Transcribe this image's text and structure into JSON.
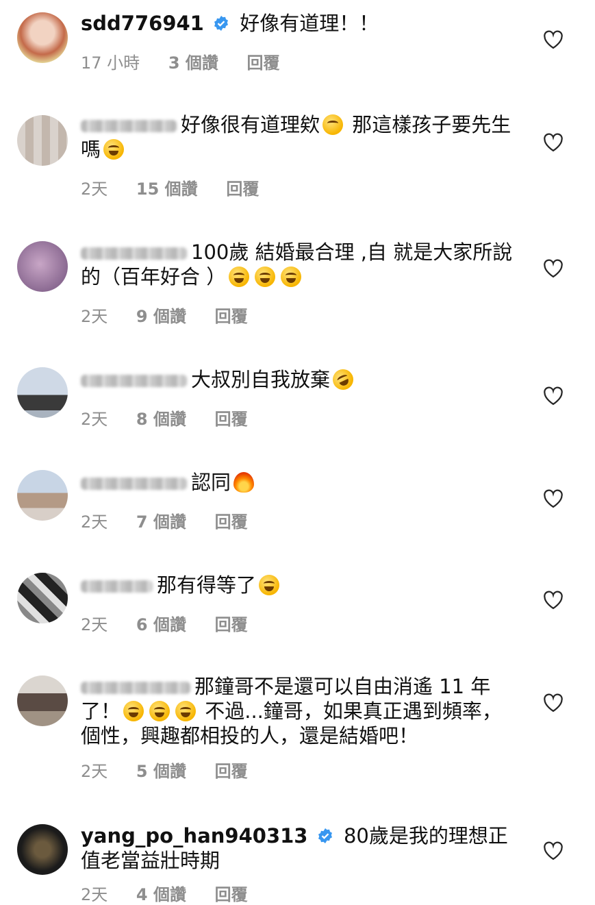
{
  "comments": [
    {
      "username": "sdd776941",
      "verified": true,
      "text": "好像有道理！！",
      "emojis": [],
      "time": "17 小時",
      "likes": "3 個讚",
      "reply": "回覆"
    },
    {
      "username": "",
      "verified": false,
      "text": "好像很有道理欸",
      "emojis_mid": [
        "thinking-emoji"
      ],
      "text2": " 那這樣孩子要先生嗎",
      "emojis": [
        "laugh-cry-emoji"
      ],
      "time": "2天",
      "likes": "15 個讚",
      "reply": "回覆"
    },
    {
      "username": "",
      "verified": false,
      "text": "100歲 結婚最合理 ,自 就是大家所說的（百年好合 ）",
      "emojis": [
        "laugh-cry-emoji",
        "laugh-cry-emoji",
        "laugh-cry-emoji"
      ],
      "time": "2天",
      "likes": "9 個讚",
      "reply": "回覆"
    },
    {
      "username": "",
      "verified": false,
      "text": "大叔別自我放棄",
      "emojis": [
        "rolling-laugh-emoji"
      ],
      "time": "2天",
      "likes": "8 個讚",
      "reply": "回覆"
    },
    {
      "username": "",
      "verified": false,
      "text": "認同",
      "emojis": [
        "fire-emoji"
      ],
      "time": "2天",
      "likes": "7 個讚",
      "reply": "回覆"
    },
    {
      "username": "",
      "verified": false,
      "text": "那有得等了",
      "emojis": [
        "laugh-cry-emoji"
      ],
      "time": "2天",
      "likes": "6 個讚",
      "reply": "回覆"
    },
    {
      "username": "",
      "verified": false,
      "text": "那鐘哥不是還可以自由消遙 11 年了！",
      "emojis_mid": [
        "laugh-cry-emoji",
        "laugh-cry-emoji",
        "laugh-cry-emoji"
      ],
      "text2": " 不過...鐘哥，如果真正遇到頻率，個性，興趣都相投的人，還是結婚吧！",
      "emojis": [],
      "time": "2天",
      "likes": "5 個讚",
      "reply": "回覆"
    },
    {
      "username": "yang_po_han940313",
      "verified": true,
      "text": "80歲是我的理想正值老當益壯時期",
      "emojis": [],
      "time": "2天",
      "likes": "4 個讚",
      "reply": "回覆"
    }
  ],
  "colors": {
    "verified": "#3897f0",
    "meta": "#8e8e8e",
    "heart": "#262626"
  }
}
